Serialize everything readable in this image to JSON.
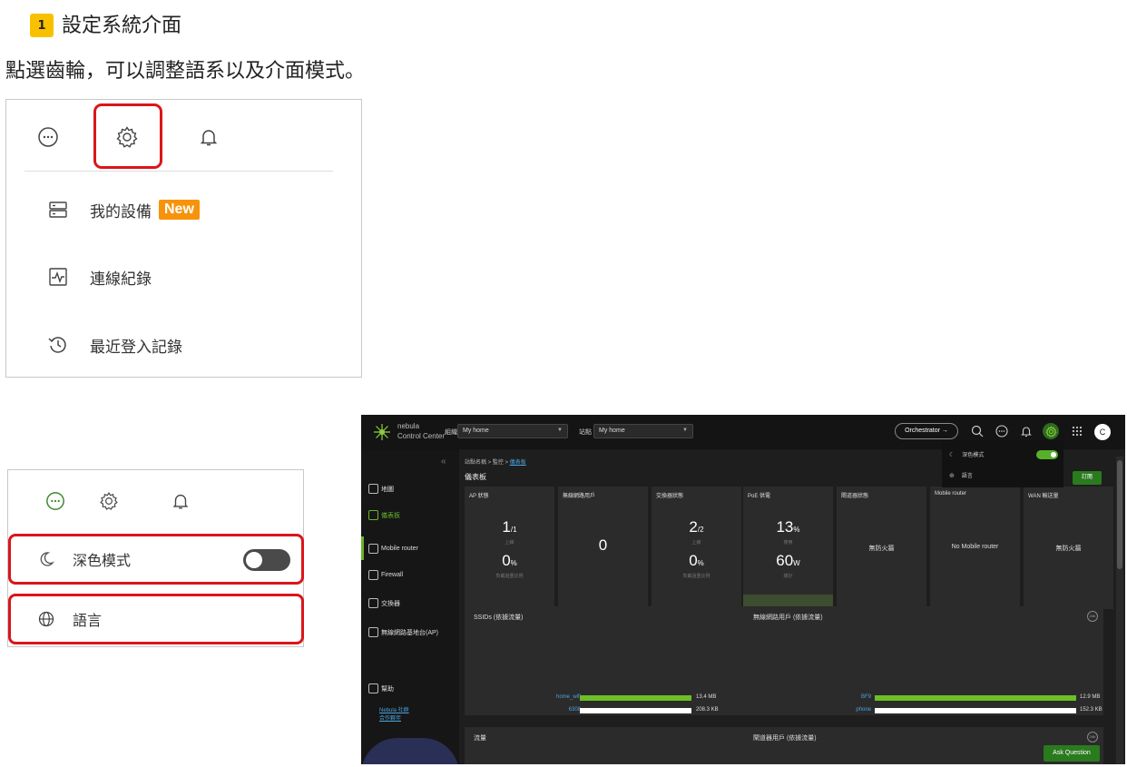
{
  "heading": {
    "step_number": "1",
    "title": "設定系統介面",
    "description": "點選齒輪，可以調整語系以及介面模式。"
  },
  "panel_settings": {
    "top_icons": [
      "more-icon",
      "gear-icon",
      "bell-icon"
    ],
    "items": [
      {
        "label": "我的設備",
        "badge": "New",
        "icon": "devices-icon"
      },
      {
        "label": "連線紀錄",
        "icon": "activity-icon"
      },
      {
        "label": "最近登入記錄",
        "icon": "history-icon"
      }
    ]
  },
  "panel_mode": {
    "top_icons": [
      "more-icon",
      "gear-icon",
      "bell-icon"
    ],
    "dark_mode_label": "深色模式",
    "dark_mode_on": false,
    "language_label": "語言"
  },
  "dashboard": {
    "brand_line1": "nebula",
    "brand_line2": "Control Center",
    "org_label": "組織",
    "org_value": "My home",
    "site_label": "站點",
    "site_value": "My home",
    "orchestrator_label": "Orchestrator →",
    "avatar_letter": "C",
    "breadcrumb_prefix": "站點名稱 > 監控 > ",
    "breadcrumb_link": "儀表板",
    "page_title": "儀表板",
    "subscribe_label": "訂閱",
    "sidebar": [
      "地圖",
      "儀表板",
      "Mobile router",
      "Firewall",
      "交換器",
      "無線網路基地台(AP)",
      "幫助"
    ],
    "sidebar_links": [
      "Nebula 社群",
      "合作夥伴"
    ],
    "cards": [
      {
        "title": "AP 狀態",
        "v1": "1",
        "v1_sub": "/1",
        "c1": "上線",
        "v2": "0",
        "v2_sub": "%",
        "c2": "負載過重比例"
      },
      {
        "title": "無線網路用戶",
        "zero": "0"
      },
      {
        "title": "交換器狀態",
        "v1": "2",
        "v1_sub": "/2",
        "c1": "上線",
        "v2": "0",
        "v2_sub": "%",
        "c2": "負載過重比例"
      },
      {
        "title": "PoE 供電",
        "v1": "13",
        "v1_sub": "%",
        "c1": "使用",
        "v2": "60",
        "v2_sub": "W",
        "c2": "總計"
      },
      {
        "title": "閘道器狀態",
        "mid": "無防火牆"
      },
      {
        "title": "Mobile router",
        "mid": "No Mobile router"
      },
      {
        "title": "WAN 輸送量",
        "mid": "無防火牆"
      }
    ],
    "ssid_panel": {
      "title": "SSIDs (依據流量)",
      "badge": "24h",
      "rows": [
        {
          "name": "home_wifi",
          "value": "13.4 MB",
          "fraction": 1.0,
          "color": "#6cc026"
        },
        {
          "name": "6308",
          "value": "208.3 KB",
          "fraction": 1.0,
          "color": "#ffffff"
        }
      ]
    },
    "clients_panel": {
      "title": "無線網路用戶 (依據流量)",
      "badge": "24h",
      "rows": [
        {
          "name": "BF9",
          "value": "12.9 MB",
          "fraction": 1.0,
          "color": "#6cc026"
        },
        {
          "name": "phone",
          "value": "152.3 KB",
          "fraction": 1.0,
          "color": "#ffffff"
        }
      ]
    },
    "traffic_panel": {
      "title": "流量",
      "badge": "24h"
    },
    "gw_clients_panel": {
      "title": "閘道器用戶 (依據流量)",
      "badge": "24h"
    },
    "dropdown": {
      "dark_mode_label": "深色模式",
      "dark_mode_on": true,
      "language_label": "語言"
    },
    "ask_label": "Ask Question"
  }
}
